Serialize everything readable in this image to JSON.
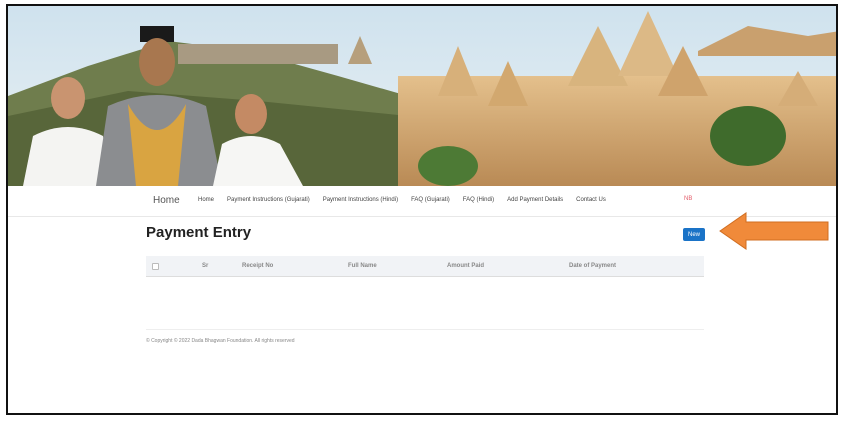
{
  "navbar": {
    "brand": "Home",
    "items": [
      "Home",
      "Payment Instructions (Gujarati)",
      "Payment Instructions (Hindi)",
      "FAQ (Gujarati)",
      "FAQ (Hindi)",
      "Add Payment Details",
      "Contact Us"
    ],
    "user_badge": "NB"
  },
  "page": {
    "title": "Payment Entry",
    "new_button_label": "New"
  },
  "table": {
    "columns": [
      "Sr",
      "Receipt No",
      "Full Name",
      "Amount Paid",
      "Date of Payment"
    ]
  },
  "footer": {
    "copyright": "© Copyright © 2022 Dada Bhagwan Foundation. All rights reserved"
  },
  "colors": {
    "primary_button": "#1a73c7",
    "arrow": "#f08a3a",
    "user_badge": "#e35d6a"
  }
}
